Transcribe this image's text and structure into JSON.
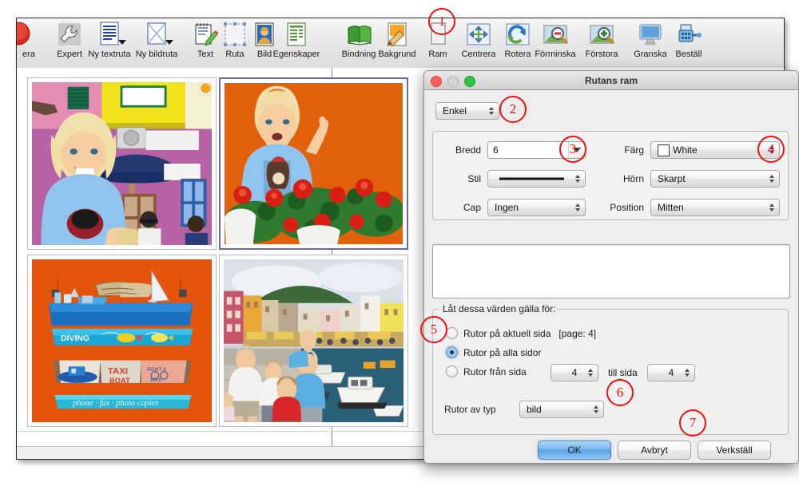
{
  "app": {
    "toolbar_items": [
      {
        "label": "era",
        "icon": "partial-red-circle-icon",
        "has_caret": false
      },
      {
        "label": "Expert",
        "icon": "wrench-icon",
        "has_caret": false
      },
      {
        "label": "Ny textruta",
        "icon": "text-box-icon",
        "has_caret": true
      },
      {
        "label": "Ny bildruta",
        "icon": "image-box-icon",
        "has_caret": true
      },
      {
        "label": "Text",
        "icon": "notepad-pencil-icon",
        "has_caret": false
      },
      {
        "label": "Ruta",
        "icon": "selection-box-icon",
        "has_caret": false
      },
      {
        "label": "Bild",
        "icon": "portrait-photo-icon",
        "has_caret": false
      },
      {
        "label": "Egenskaper",
        "icon": "properties-list-icon",
        "has_caret": false
      },
      {
        "label": "Bindning",
        "icon": "green-book-icon",
        "has_caret": false
      },
      {
        "label": "Bakgrund",
        "icon": "paint-brush-icon",
        "has_caret": false
      },
      {
        "label": "Ram",
        "icon": "frame-icon",
        "has_caret": false
      },
      {
        "label": "Centrera",
        "icon": "center-arrows-icon",
        "has_caret": false
      },
      {
        "label": "Rotera",
        "icon": "rotate-icon",
        "has_caret": false
      },
      {
        "label": "Förminska",
        "icon": "zoom-out-icon",
        "has_caret": false
      },
      {
        "label": "Förstora",
        "icon": "zoom-in-icon",
        "has_caret": false
      },
      {
        "label": "Granska",
        "icon": "monitor-preview-icon",
        "has_caret": false
      },
      {
        "label": "Beställ",
        "icon": "cash-register-order-icon",
        "has_caret": false
      }
    ],
    "photos": [
      {
        "name": "photo-boy-pink-yellow-house",
        "alt": "Blond boy smiling in front of pink and yellow houses"
      },
      {
        "name": "photo-boy-orange-wall-flowers",
        "alt": "Blond boy pointing, orange wall with red geraniums"
      },
      {
        "name": "photo-driftwood-signs",
        "alt": "Painted driftwood boat signs on orange wall: DIVING, TAXI BOAT, phone fax photo copies"
      },
      {
        "name": "photo-harbour-family",
        "alt": "Family standing on harbour quay with boats and colourful houses"
      }
    ]
  },
  "dialog": {
    "title": "Rutans ram",
    "traffic_lights": [
      "close-red",
      "minimize-disabled",
      "zoom-green"
    ],
    "frame_type": {
      "label": "",
      "value": "Enkel"
    },
    "fields": {
      "bredd_label": "Bredd",
      "bredd_value": "6",
      "stil_label": "Stil",
      "stil_value": "solid-line",
      "cap_label": "Cap",
      "cap_value": "Ingen",
      "farg_label": "Färg",
      "farg_value": "White",
      "farg_swatch": "#ffffff",
      "horn_label": "Hörn",
      "horn_value": "Skarpt",
      "position_label": "Position",
      "position_value": "Mitten"
    },
    "apply_group": {
      "legend": "Låt dessa värden gälla för:",
      "radios": [
        {
          "label": "Rutor på aktuell sida",
          "suffix": "[page: 4]",
          "selected": false
        },
        {
          "label": "Rutor på alla sidor",
          "suffix": "",
          "selected": true
        },
        {
          "label": "Rutor från sida",
          "suffix": "",
          "selected": false
        }
      ],
      "from_page": "4",
      "to_label": "till sida",
      "to_page": "4",
      "type_label": "Rutor av typ",
      "type_value": "bild"
    },
    "buttons": {
      "ok": "OK",
      "cancel": "Avbryt",
      "apply": "Verkställ"
    }
  },
  "annotations": [
    {
      "number": "1"
    },
    {
      "number": "2"
    },
    {
      "number": "3"
    },
    {
      "number": "4"
    },
    {
      "number": "5"
    },
    {
      "number": "6"
    },
    {
      "number": "7"
    }
  ]
}
